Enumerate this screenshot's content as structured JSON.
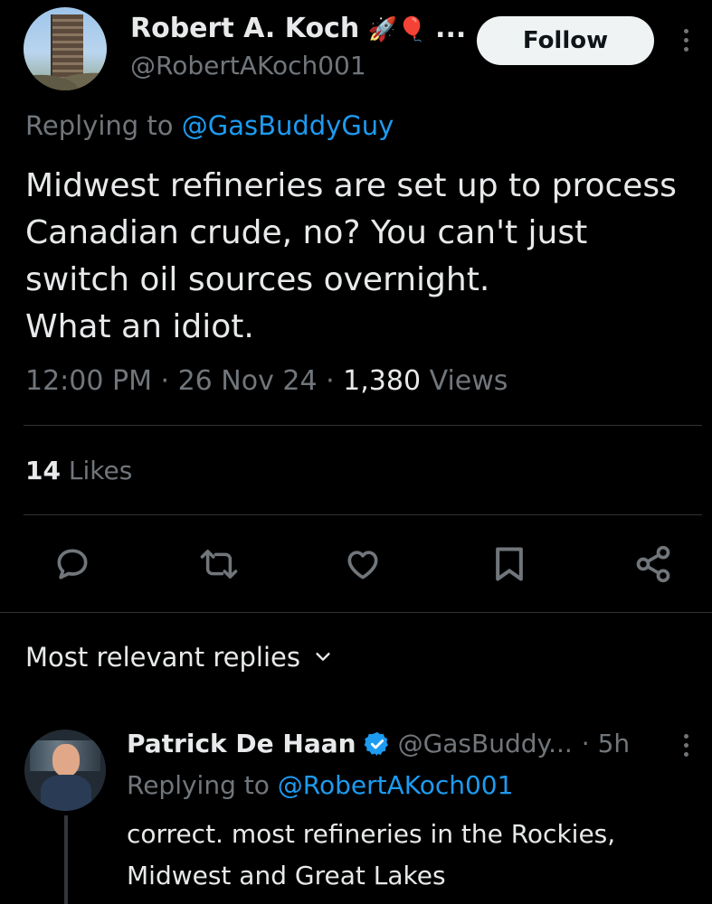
{
  "tweet": {
    "author_name": "Robert A. Koch",
    "author_emojis": "🚀🎈",
    "author_name_ellipsis": "...",
    "author_handle": "@RobertAKoch001",
    "follow_label": "Follow",
    "replying_to_prefix": "Replying to ",
    "replying_to_handle": "@GasBuddyGuy",
    "text_lines": [
      "Midwest refineries are set up to process",
      "Canadian crude, no? You can't just",
      "switch oil sources overnight.",
      "What an idiot."
    ],
    "time": "12:00 PM",
    "date": "26 Nov 24",
    "separator": " · ",
    "views_count": "1,380",
    "views_label": " Views",
    "likes_count": "14",
    "likes_label": " Likes"
  },
  "actions": [
    "reply-icon",
    "retweet-icon",
    "like-icon",
    "bookmark-icon",
    "share-icon"
  ],
  "replies_header": {
    "label": "Most relevant replies"
  },
  "reply": {
    "author_name": "Patrick De Haan",
    "verified": true,
    "author_handle": "@GasBuddy...",
    "time": "· 5h",
    "replying_to_prefix": "Replying to ",
    "replying_to_handle": "@RobertAKoch001",
    "text_lines": [
      "correct. most refineries in the Rockies,",
      "Midwest and Great Lakes"
    ]
  },
  "colors": {
    "background": "#000000",
    "text": "#e7e9ea",
    "muted": "#71767b",
    "link": "#1d9bf0",
    "divider": "#2f3336",
    "follow_bg": "#eff3f4"
  }
}
